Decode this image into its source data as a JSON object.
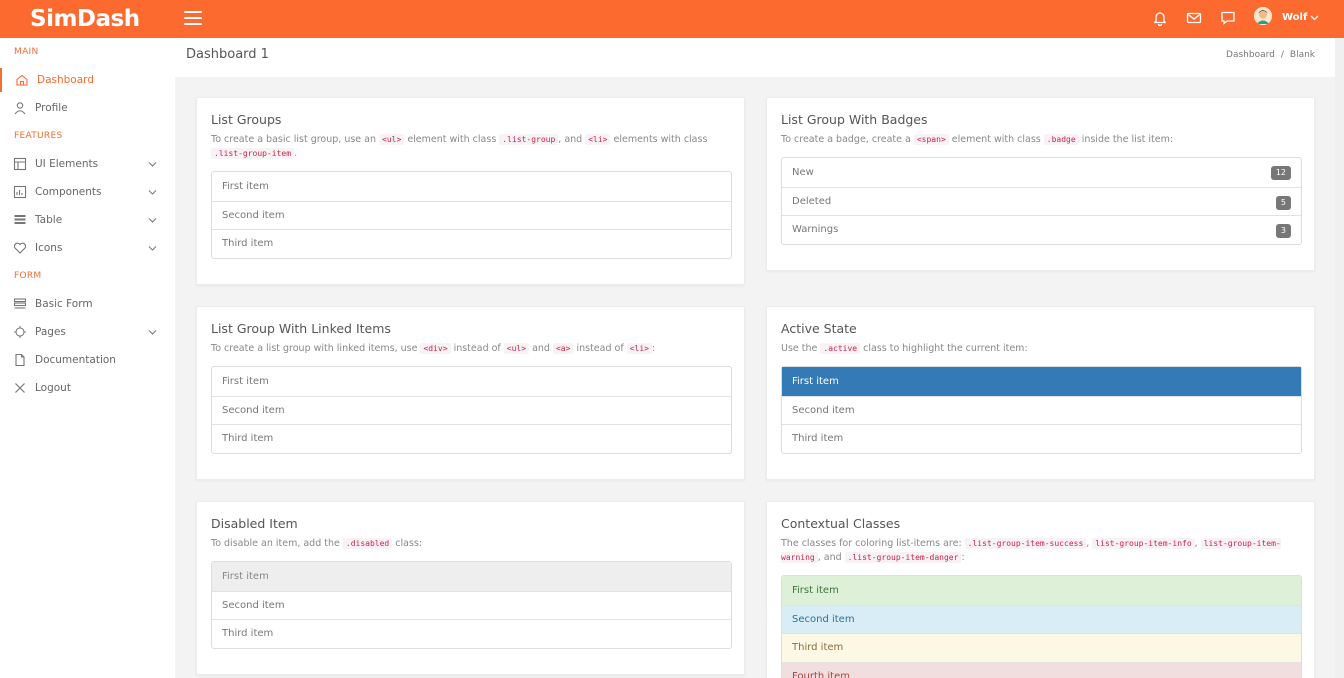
{
  "brand": {
    "logo_text": "SimDash",
    "accent": "#fc6a30"
  },
  "topbar": {
    "user_name": "Wolf"
  },
  "sidebar": {
    "sections": [
      "MAIN",
      "FEATURES",
      "FORM"
    ],
    "items": [
      {
        "label": "Dashboard",
        "icon": "home-icon"
      },
      {
        "label": "Profile",
        "icon": "user-icon"
      },
      {
        "label": "UI Elements",
        "icon": "layout-icon"
      },
      {
        "label": "Components",
        "icon": "chart-icon"
      },
      {
        "label": "Table",
        "icon": "table-icon"
      },
      {
        "label": "Icons",
        "icon": "heart-icon"
      },
      {
        "label": "Basic Form",
        "icon": "form-icon"
      },
      {
        "label": "Pages",
        "icon": "target-icon"
      },
      {
        "label": "Documentation",
        "icon": "document-icon"
      },
      {
        "label": "Logout",
        "icon": "close-icon"
      }
    ]
  },
  "header": {
    "title": "Dashboard 1",
    "breadcrumb": [
      "Dashboard",
      "/",
      "Blank"
    ]
  },
  "cards": {
    "list_groups": {
      "title": "List Groups",
      "desc": [
        "To create a basic list group, use an ",
        "<ul>",
        " element with class ",
        ".list-group",
        ", and ",
        "<li>",
        " elements with class ",
        ".list-group-item",
        "."
      ],
      "items": [
        "First item",
        "Second item",
        "Third item"
      ]
    },
    "badges": {
      "title": "List Group With Badges",
      "desc": [
        "To create a badge, create a ",
        "<span>",
        " element with class ",
        ".badge",
        " inside the list item:"
      ],
      "items": [
        {
          "label": "New",
          "badge": "12"
        },
        {
          "label": "Deleted",
          "badge": "5"
        },
        {
          "label": "Warnings",
          "badge": "3"
        }
      ]
    },
    "linked": {
      "title": "List Group With Linked Items",
      "desc": [
        "To create a list group with linked items, use ",
        "<div>",
        " instead of ",
        "<ul>",
        " and ",
        "<a>",
        " instead of ",
        "<li>",
        ":"
      ],
      "items": [
        "First item",
        "Second item",
        "Third item"
      ]
    },
    "active": {
      "title": "Active State",
      "desc": [
        "Use the ",
        ".active",
        " class to highlight the current item:"
      ],
      "items": [
        "First item",
        "Second item",
        "Third item"
      ]
    },
    "disabled": {
      "title": "Disabled Item",
      "desc": [
        "To disable an item, add the ",
        ".disabled",
        " class:"
      ],
      "items": [
        "First item",
        "Second item",
        "Third item"
      ]
    },
    "contextual": {
      "title": "Contextual Classes",
      "desc": [
        "The classes for coloring list-items are: ",
        ".list-group-item-success",
        ", ",
        "list-group-item-info",
        ", ",
        "list-group-item-warning",
        ", and ",
        ".list-group-item-danger",
        ":"
      ],
      "items": [
        "First item",
        "Second item",
        "Third item",
        "Fourth item"
      ]
    }
  }
}
